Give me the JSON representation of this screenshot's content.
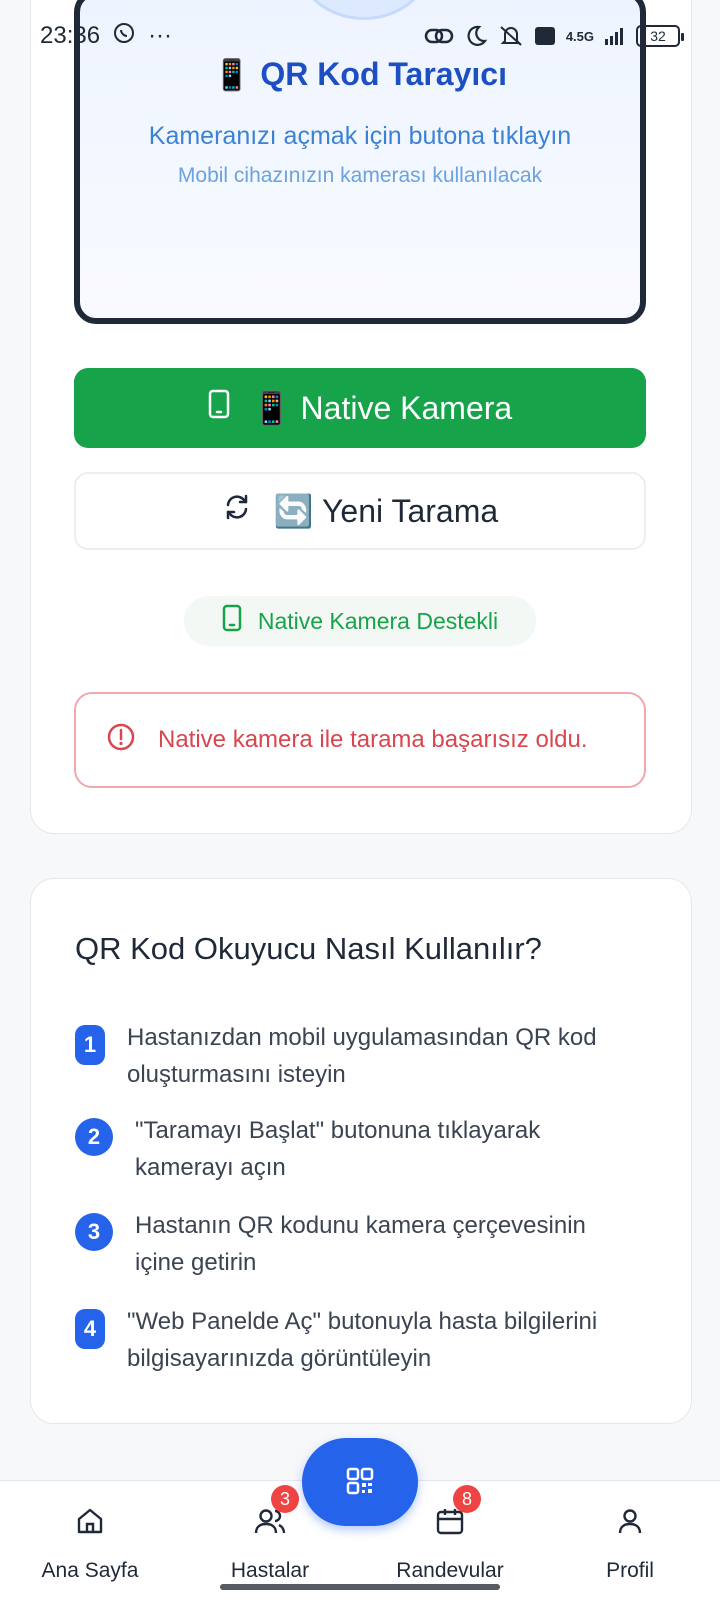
{
  "status_bar": {
    "time": "23:36",
    "dots": "···",
    "network": "4.5G",
    "battery": "32"
  },
  "scanner": {
    "title_emoji": "📱",
    "title": "QR Kod Tarayıcı",
    "instruction": "Kameranızı açmak için butona tıklayın",
    "subinstruction": "Mobil cihazınızın kamerası kullanılacak"
  },
  "actions": {
    "native_camera_label": "📱 Native Kamera",
    "new_scan_label": "🔄 Yeni Tarama"
  },
  "support_badge": "Native Kamera Destekli",
  "error_message": "Native kamera ile tarama başarısız oldu.",
  "help": {
    "title": "QR Kod Okuyucu Nasıl Kullanılır?",
    "steps": [
      {
        "num": "1",
        "text_line1": "Hastanızdan mobil uygulamasından QR kod",
        "text_line2": "oluşturmasını isteyin"
      },
      {
        "num": "2",
        "text_line1": "\"Taramayı Başlat\" butonuna tıklayarak",
        "text_line2": "kamerayı açın"
      },
      {
        "num": "3",
        "text_line1": "Hastanın QR kodunu kamera çerçevesinin",
        "text_line2": "içine getirin"
      },
      {
        "num": "4",
        "text_line1": "\"Web Panelde Aç\" butonuyla hasta bilgilerini",
        "text_line2": "bilgisayarınızda görüntüleyin"
      }
    ]
  },
  "bottom_nav": {
    "home": "Ana Sayfa",
    "patients": "Hastalar",
    "patients_badge": "3",
    "appointments": "Randevular",
    "appointments_badge": "8",
    "profile": "Profil"
  },
  "colors": {
    "primary": "#2563eb",
    "success": "#16a34a",
    "danger": "#d9464f",
    "badge": "#ef4444"
  }
}
